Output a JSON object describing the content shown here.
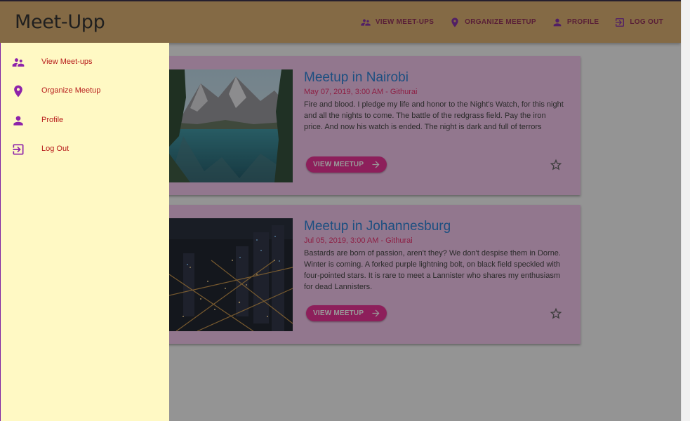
{
  "app": {
    "title": "Meet-Upp"
  },
  "toolbar": {
    "items": [
      {
        "label": "VIEW MEET-UPS",
        "icon": "supervisor-account-icon"
      },
      {
        "label": "ORGANIZE MEETUP",
        "icon": "location-pin-icon"
      },
      {
        "label": "PROFILE",
        "icon": "person-icon"
      },
      {
        "label": "LOG OUT",
        "icon": "exit-to-app-icon"
      }
    ]
  },
  "drawer": {
    "items": [
      {
        "label": "View Meet-ups",
        "icon": "supervisor-account-icon"
      },
      {
        "label": "Organize Meetup",
        "icon": "location-pin-icon"
      },
      {
        "label": "Profile",
        "icon": "person-icon"
      },
      {
        "label": "Log Out",
        "icon": "exit-to-app-icon"
      }
    ]
  },
  "meetups": [
    {
      "title": "Meetup in Nairobi",
      "meta": "May 07, 2019, 3:00 AM - Githurai",
      "description": "Fire and blood. I pledge my life and honor to the Night's Watch, for this night and all the nights to come. The battle of the redgrass field. Pay the iron price. And now his watch is ended. The night is dark and full of terrors",
      "button_label": "VIEW MEETUP",
      "image": "mountain-lake-image"
    },
    {
      "title": "Meetup in Johannesburg",
      "meta": "Jul 05, 2019, 3:00 AM - Githurai",
      "description": "Bastards are born of passion, aren't they? We don't despise them in Dorne. Winter is coming. A forked purple lightning bolt, on black field speckled with four-pointed stars. It is rare to meet a Lannister who shares my enthusiasm for dead Lannisters.",
      "button_label": "VIEW MEETUP",
      "image": "city-night-aerial-image"
    }
  ],
  "colors": {
    "toolbar": "#d8a864",
    "drawer": "#fff9c4",
    "card": "#f3c0ea",
    "title": "#1976d2",
    "accent": "#e91e63",
    "drawer_text": "#b71c1c"
  }
}
